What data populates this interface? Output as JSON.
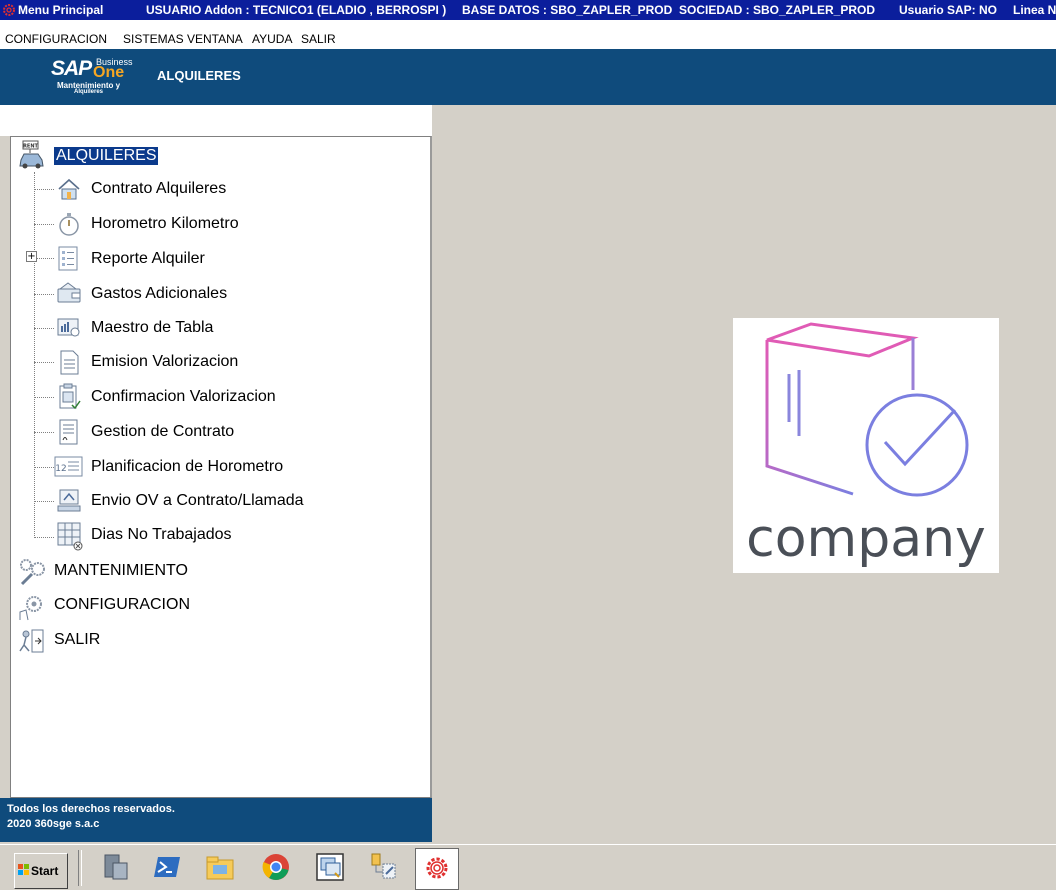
{
  "titlebar": {
    "app": "Menu Principal",
    "user": "USUARIO Addon : TECNICO1  (ELADIO , BERROSPI )",
    "db": "BASE DATOS : SBO_ZAPLER_PROD",
    "company": "SOCIEDAD : SBO_ZAPLER_PROD",
    "sap_user": "Usuario SAP:  NO",
    "line": "Linea No"
  },
  "menubar": {
    "items": [
      "CONFIGURACION",
      "SISTEMAS",
      "VENTANA",
      "AYUDA",
      "SALIR"
    ]
  },
  "banner": {
    "logo_sap": "SAP",
    "logo_business": "Business",
    "logo_one": "One",
    "logo_sub1": "Mantenimiento y",
    "logo_sub2": "Alquileres",
    "title": "ALQUILERES"
  },
  "tree": {
    "root": "ALQUILERES",
    "root_badge": "RENT",
    "children": [
      "Contrato Alquileres",
      "Horometro Kilometro",
      "Reporte Alquiler",
      "Gastos Adicionales",
      "Maestro de Tabla",
      "Emision Valorizacion",
      "Confirmacion Valorizacion",
      "Gestion de Contrato",
      "Planificacion de Horometro",
      "Envio OV a Contrato/Llamada",
      "Dias No Trabajados"
    ],
    "expander": "+",
    "top_level": [
      "MANTENIMIENTO",
      "CONFIGURACION",
      "SALIR"
    ]
  },
  "footer": {
    "line1": "Todos los derechos reservados.",
    "line2": "2020 360sge s.a.c"
  },
  "company_logo": {
    "text": "company",
    "colors": {
      "pink": "#e05bb5",
      "purple": "#7b7fe0",
      "text": "#4a4f57"
    }
  },
  "taskbar": {
    "start": "Start",
    "apps": [
      "server-manager-icon",
      "powershell-icon",
      "file-explorer-icon",
      "chrome-icon",
      "cascade-windows-icon",
      "network-tools-icon",
      "gear-icon"
    ]
  },
  "colors": {
    "titlebar_bg": "#0b1e9c",
    "banner_bg": "#0f4b7c",
    "selected_bg": "#0b3a8c",
    "workspace_bg": "#d4d0c8"
  }
}
